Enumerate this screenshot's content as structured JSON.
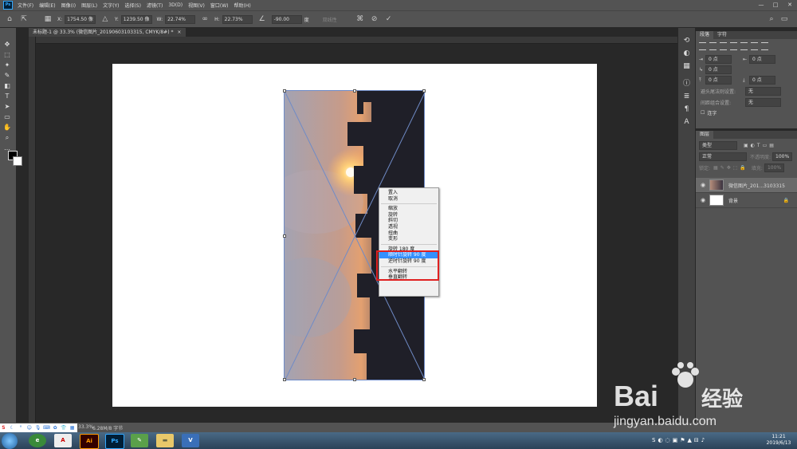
{
  "menubar": {
    "app_icon": "Ps",
    "items": [
      "文件(F)",
      "编辑(E)",
      "图像(I)",
      "图层(L)",
      "文字(Y)",
      "选择(S)",
      "滤镜(T)",
      "3D(D)",
      "视图(V)",
      "窗口(W)",
      "帮助(H)"
    ],
    "window_controls": [
      "—",
      "□",
      "✕"
    ]
  },
  "options_bar": {
    "x_label": "X:",
    "x_value": "1754.50 像",
    "y_label": "Y:",
    "y_value": "1239.50 像",
    "w_label": "W:",
    "w_value": "22.74%",
    "h_label": "H:",
    "h_value": "22.73%",
    "angle_value": "-90.00",
    "angle_unit": "度",
    "interp_label": "双线性"
  },
  "document_tab": {
    "title": "未标题-1 @ 33.3% (微信图片_20190603103315, CMYK/8#) *",
    "close": "×"
  },
  "context_menu": {
    "group1": [
      "置入",
      "取消"
    ],
    "group2": [
      "缩放",
      "旋转",
      "斜切",
      "透视",
      "扭曲",
      "变形"
    ],
    "group3": [
      "旋转 180 度",
      "顺时针旋转 90 度",
      "逆时针旋转 90 度"
    ],
    "group4": [
      "水平翻转",
      "垂直翻转"
    ],
    "highlighted": "顺时针旋转 90 度"
  },
  "paragraph_panel": {
    "tabs": [
      "段落",
      "字符"
    ],
    "indent_values": [
      "0 点",
      "0 点",
      "0 点",
      "0 点",
      "0 点"
    ],
    "row1_label": "避头尾法则设置:",
    "row1_value": "无",
    "row2_label": "间距组合设置:",
    "row2_value": "无",
    "hyphen_label": "连字"
  },
  "layers_panel": {
    "tabs": [
      "图层"
    ],
    "filter_label": "类型",
    "blend_mode": "正常",
    "opacity_label": "不透明度:",
    "opacity_value": "100%",
    "lock_label": "锁定:",
    "fill_label": "填充:",
    "fill_value": "100%",
    "layers": [
      {
        "name": "微信图片_201...3103315",
        "selected": true
      },
      {
        "name": "背景",
        "selected": false
      }
    ]
  },
  "status_bar": {
    "zoom": "33.3%",
    "doc_info": "6.28M/8 字节"
  },
  "taskbar": {
    "apps": [
      "Ai",
      "Ps"
    ],
    "clock_time": "11:21",
    "clock_date": "2019/6/13"
  },
  "watermark": {
    "brand": "Bai",
    "brand2": "经验",
    "url": "jingyan.baidu.com"
  },
  "colors": {
    "accent_highlight": "#3390ff",
    "annotation_red": "#e02020",
    "panel_bg": "#535353"
  }
}
